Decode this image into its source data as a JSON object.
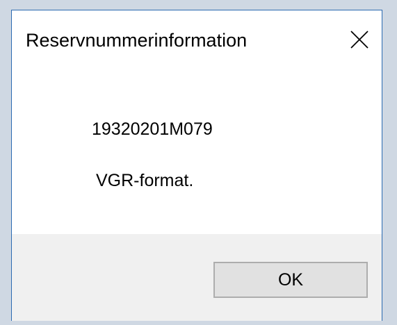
{
  "dialog": {
    "title": "Reservnummerinformation",
    "close_icon": "close-icon",
    "message": {
      "number": "19320201M079",
      "format": "VGR-format."
    },
    "ok_label": "OK"
  },
  "colors": {
    "window_border": "#2b6ab1",
    "footer_bg": "#f0f0f0",
    "button_bg": "#e1e1e1",
    "button_border": "#adadad"
  }
}
